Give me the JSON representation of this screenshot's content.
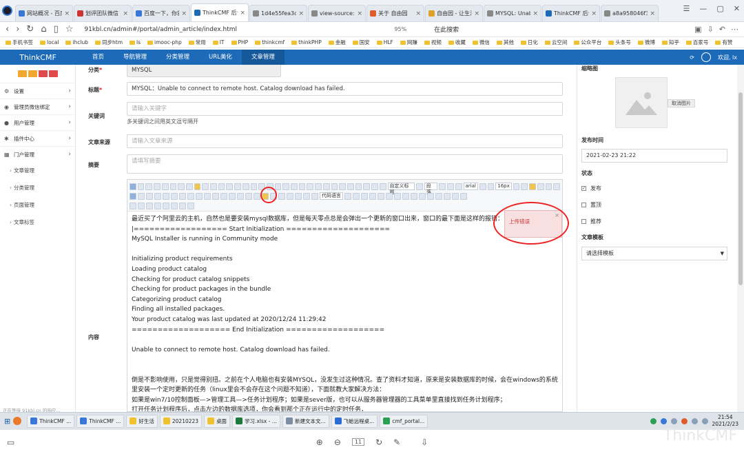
{
  "browser": {
    "tabs": [
      {
        "title": "网站概况 - 百度",
        "color": "#3a77d6"
      },
      {
        "title": "划评团队微信",
        "color": "#c33"
      },
      {
        "title": "百度一下，你就知",
        "color": "#3a77d6"
      },
      {
        "title": "ThinkCMF 后台",
        "color": "#1d6bb8"
      },
      {
        "title": "1d4e55fea3ca4",
        "color": "#888"
      },
      {
        "title": "view-source:91",
        "color": "#888"
      },
      {
        "title": "关于 自由园",
        "color": "#e05b2a"
      },
      {
        "title": "自由园 - 让生活",
        "color": "#e0a12a"
      },
      {
        "title": "MYSQL: Unab",
        "color": "#888"
      },
      {
        "title": "ThinkCMF 后台",
        "color": "#1d6bb8"
      },
      {
        "title": "a8a958046f361",
        "color": "#888"
      }
    ],
    "url": "91kbl.cn/admin#/portal/admin_article/index.html",
    "zoom": "95%",
    "search": "在此搜索",
    "bookmarks": [
      "手机书签",
      "local",
      "ihclub",
      "同步htm",
      "ls",
      "imooc-php",
      "常用",
      "IT",
      "PHP",
      "thinkcmf",
      "thinkPHP",
      "金融",
      "国安",
      "HLF",
      "网赚",
      "视频",
      "收藏",
      "微信",
      "其他",
      "日化",
      "云空间",
      "公众平台",
      "头条号",
      "微博",
      "知乎",
      "百家号",
      "有赞"
    ]
  },
  "app": {
    "brand": "ThinkCMF",
    "menu": [
      "首页",
      "导航管理",
      "分类管理",
      "URL美化",
      "文章管理"
    ],
    "user": "欢迎, lx"
  },
  "sidebar": {
    "items": [
      {
        "label": "设置",
        "icon": "gear-icon",
        "glyph": "⚙"
      },
      {
        "label": "管理员微信绑定",
        "icon": "wechat-icon",
        "glyph": "◉"
      },
      {
        "label": "用户管理",
        "icon": "user-icon",
        "glyph": "●"
      },
      {
        "label": "插件中心",
        "icon": "plugin-icon",
        "glyph": "✱"
      },
      {
        "label": "门户管理",
        "icon": "grid-icon",
        "glyph": "▦"
      }
    ],
    "subs": [
      "文章管理",
      "分类管理",
      "页面管理",
      "文章标签"
    ]
  },
  "form": {
    "category_label": "分类",
    "category_value": "MYSQL",
    "title_label": "标题",
    "title_value": "MYSQL：Unable to connect to remote host. Catalog download has failed.",
    "keywords_label": "关键词",
    "keywords_placeholder": "请输入关键字",
    "keywords_hint": "多关键词之间用英文逗号隔开",
    "source_label": "文章来源",
    "source_placeholder": "请输入文章来源",
    "summary_label": "摘要",
    "summary_placeholder": "请填写摘要",
    "content_label": "内容"
  },
  "editor": {
    "selects": [
      "自定义标题",
      "段落",
      "arial",
      "16px",
      "代码语言"
    ],
    "lines": [
      "最近买了个阿里云的主机，自然也是要安装mysql数据库，但是每天零点总是会弹出一个更新的窗口出来，窗口的最下面是这样的报错：",
      "|================== Start Initialization ====================",
      "MySQL Installer is running in Community mode",
      "",
      "Initializing product requirements",
      "Loading product catalog",
      "Checking for product catalog snippets",
      "Checking for product packages in the bundle",
      "Categorizing product catalog",
      "Finding all installed packages.",
      "Your product catalog was last updated at 2020/12/24 11:29:42",
      "=================== End Initialization ===================",
      "",
      "Unable to connect to remote host.  Catalog download has failed.",
      "",
      "",
      "倒是不影响使用，只是觉得别扭。之前在个人电脑也有安装MYSQL，没发生过这种情况。查了资料才知道，原来是安装数据库的时候，会在windows的系统",
      "里安装一个定时更新的任务（linux里会不会存在这个问题不知道），下面就教大家解决方法：",
      "如果是win7/10控制面板—>管理工具—>任务计划程序；如果是sever版，也可以从服务器管理器的工具菜单里直接找到任务计划程序；",
      "打开任务计划程序后，点击左边的数据库选项，你会看到那个正在运行中的定时任务，"
    ],
    "toast": "上传错误"
  },
  "right": {
    "thumb_label": "缩略图",
    "cancel_image": "取消图片",
    "publish_time_label": "发布时间",
    "publish_time": "2021-02-23 21:22",
    "status_label": "状态",
    "status_options": [
      {
        "label": "发布",
        "checked": true
      },
      {
        "label": "置顶",
        "checked": false
      },
      {
        "label": "推荐",
        "checked": false
      }
    ],
    "template_label": "文章模板",
    "template_select": "请选择模板"
  },
  "status_bar": "正在等待 91kbl.cn 的响应...",
  "taskbar": {
    "items": [
      {
        "label": "ThinkCMF ...",
        "color": "#3a77d6"
      },
      {
        "label": "ThinkCMF ...",
        "color": "#3a77d6"
      },
      {
        "label": "好生活",
        "color": "#f1c230"
      },
      {
        "label": "20210223",
        "color": "#f1c230"
      },
      {
        "label": "桌面",
        "color": "#f1c230"
      },
      {
        "label": "学习.xlsx - ...",
        "color": "#1e7a3c"
      },
      {
        "label": "新建文本文...",
        "color": "#7a8da3"
      },
      {
        "label": "飞蛤远程桌...",
        "color": "#2a6bd6"
      },
      {
        "label": "cmf_portal...",
        "color": "#2aa152"
      }
    ],
    "time": "21:54",
    "date": "2021/2/23"
  },
  "viewer": {
    "page": "11"
  },
  "watermark": "ThinkCMF"
}
